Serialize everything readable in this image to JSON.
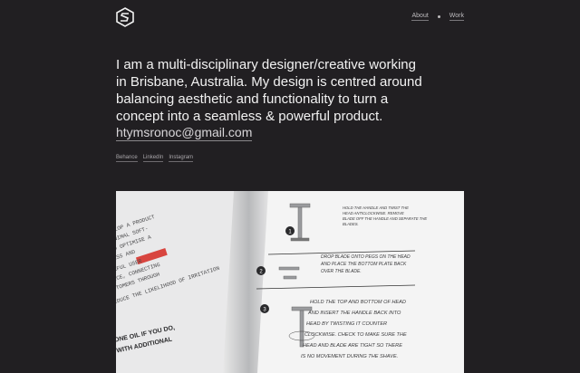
{
  "header": {
    "logo_icon": "hexagon-s-logo-icon",
    "nav": [
      {
        "label": "About"
      },
      {
        "label": "Work"
      }
    ]
  },
  "intro": {
    "text": "I am a multi-disciplinary designer/creative working in Brisbane, Australia. My design is centred around balancing aesthetic and functionality to turn a concept into a seamless & powerful product."
  },
  "contact": {
    "email": "htymsronoc@gmail.com"
  },
  "social": [
    {
      "label": "Behance"
    },
    {
      "label": "LinkedIn"
    },
    {
      "label": "Instagram"
    }
  ],
  "hero_image": {
    "left_page_lines": [
      "AND DEVELOP A PRODUCT",
      "WITH MINIMAL SOFT-",
      "WARE TO OPTIMISE A",
      "SEAMLESS AND",
      "POWERFUL USER",
      "DEVICE, CONNECTING",
      "CUSTOMERS THROUGH",
      "REDUCE THE LIKELIHOOD OF IRRITATION",
      "ONE OIL IF YOU DO,",
      "WITH ADDITIONAL"
    ],
    "right_page_lines": [
      "HOLD THE HANDLE AND TWIST THE",
      "HEAD ANTICLOCKWISE. REMOVE",
      "BLADE OFF THE HANDLE AND SEPARATE THE",
      "BLADES.",
      "DROP BLADE ONTO PEGS ON THE HEAD",
      "AND PLACE THE BOTTOM PLATE BACK",
      "OVER THE BLADE.",
      "HOLD THE TOP AND BOTTOM OF HEAD",
      "AND INSERT THE HANDLE BACK INTO",
      "HEAD BY TWISTING IT COUNTER",
      "CLOCKWISE. CHECK TO MAKE SURE THE",
      "HEAD AND BLADE ARE TIGHT SO THERE",
      "IS NO MOVEMENT DURING THE SHAVE."
    ],
    "step_numbers": [
      "1",
      "2",
      "3"
    ]
  }
}
